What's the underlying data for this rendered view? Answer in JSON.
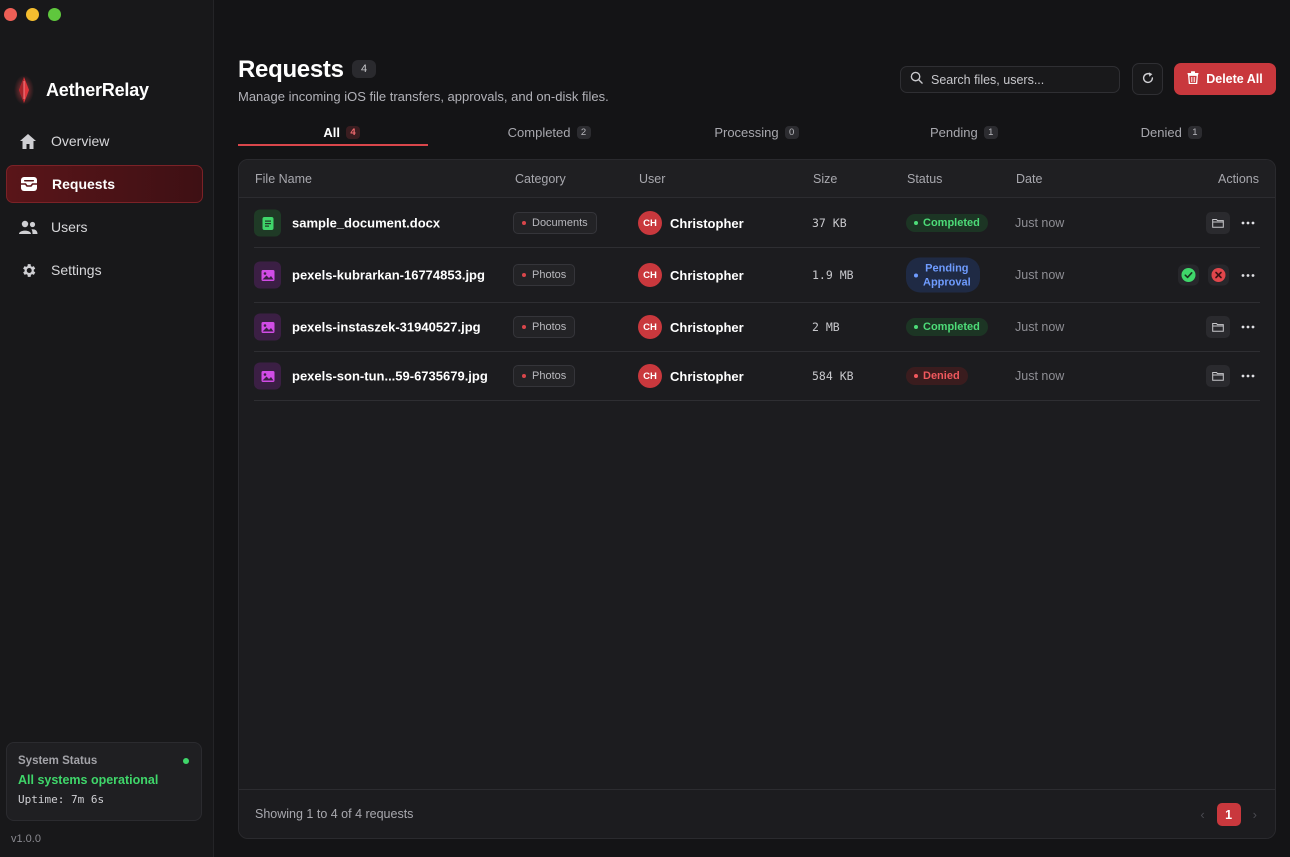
{
  "window": {
    "controls": [
      "close",
      "minimize",
      "zoom"
    ]
  },
  "brand": {
    "name": "AetherRelay",
    "logo": "crystal-logo",
    "accent": "#c9383d"
  },
  "sidebar": {
    "items": [
      {
        "label": "Overview",
        "icon": "home-icon",
        "active": false
      },
      {
        "label": "Requests",
        "icon": "inbox-icon",
        "active": true
      },
      {
        "label": "Users",
        "icon": "users-icon",
        "active": false
      },
      {
        "label": "Settings",
        "icon": "gear-icon",
        "active": false
      }
    ],
    "status": {
      "title": "System Status",
      "text": "All systems operational",
      "uptime": "Uptime: 7m 6s"
    },
    "version": "v1.0.0"
  },
  "header": {
    "title": "Requests",
    "count": "4",
    "subtitle": "Manage incoming iOS file transfers, approvals, and on-disk files.",
    "search_placeholder": "Search files, users...",
    "delete_all_label": "Delete All"
  },
  "tabs": [
    {
      "label": "All",
      "count": "4",
      "active": true
    },
    {
      "label": "Completed",
      "count": "2",
      "active": false
    },
    {
      "label": "Processing",
      "count": "0",
      "active": false
    },
    {
      "label": "Pending",
      "count": "1",
      "active": false
    },
    {
      "label": "Denied",
      "count": "1",
      "active": false
    }
  ],
  "table": {
    "columns": {
      "file_name": "File Name",
      "category": "Category",
      "user": "User",
      "size": "Size",
      "status": "Status",
      "date": "Date",
      "actions": "Actions"
    },
    "rows": [
      {
        "file_name": "sample_document.docx",
        "file_type": "document",
        "category": "Documents",
        "user_initials": "CH",
        "user": "Christopher",
        "size": "37 KB",
        "status": "Completed",
        "status_kind": "completed",
        "date": "Just now"
      },
      {
        "file_name": "pexels-kubrarkan-16774853.jpg",
        "file_type": "image",
        "category": "Photos",
        "user_initials": "CH",
        "user": "Christopher",
        "size": "1.9 MB",
        "status_line1": "Pending",
        "status_line2": "Approval",
        "status_kind": "pending",
        "date": "Just now"
      },
      {
        "file_name": "pexels-instaszek-31940527.jpg",
        "file_type": "image",
        "category": "Photos",
        "user_initials": "CH",
        "user": "Christopher",
        "size": "2 MB",
        "status": "Completed",
        "status_kind": "completed",
        "date": "Just now"
      },
      {
        "file_name": "pexels-son-tun...59-6735679.jpg",
        "file_type": "image",
        "category": "Photos",
        "user_initials": "CH",
        "user": "Christopher",
        "size": "584 KB",
        "status": "Denied",
        "status_kind": "denied",
        "date": "Just now"
      }
    ],
    "footer": {
      "showing": "Showing 1 to 4 of 4 requests",
      "current_page": "1"
    }
  }
}
